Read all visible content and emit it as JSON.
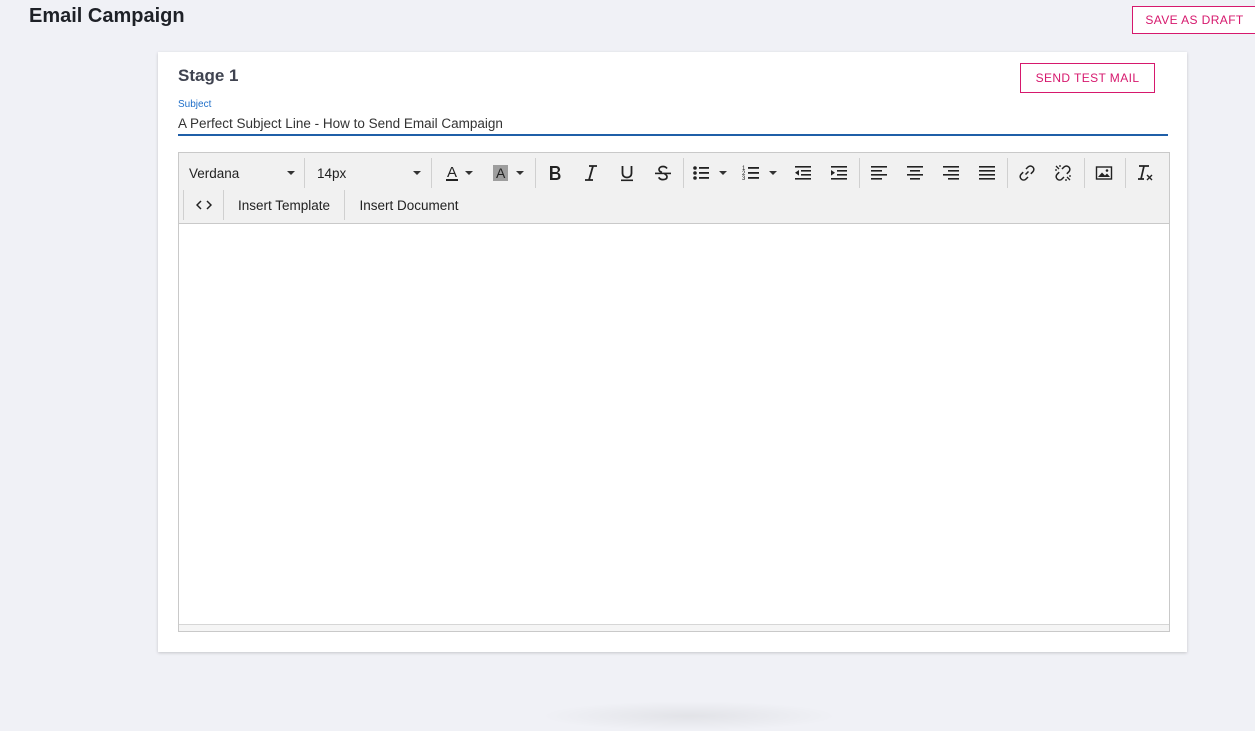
{
  "header": {
    "title": "Email Campaign",
    "save_draft_label": "SAVE AS DRAFT"
  },
  "stage": {
    "title": "Stage 1",
    "send_test_label": "SEND TEST MAIL",
    "subject_label": "Subject",
    "subject_value": "A Perfect Subject Line - How to Send Email Campaign"
  },
  "toolbar": {
    "font_family": "Verdana",
    "font_size": "14px",
    "insert_template_label": "Insert Template",
    "insert_document_label": "Insert Document",
    "icons": [
      "font-color-icon",
      "highlight-color-icon",
      "bold-icon",
      "italic-icon",
      "underline-icon",
      "strikethrough-icon",
      "bulleted-list-icon",
      "numbered-list-icon",
      "outdent-icon",
      "indent-icon",
      "align-left-icon",
      "align-center-icon",
      "align-right-icon",
      "align-justify-icon",
      "link-icon",
      "unlink-icon",
      "image-icon",
      "clear-formatting-icon",
      "source-code-icon"
    ]
  },
  "colors": {
    "accent": "#d6186d",
    "input_underline": "#1f5fa8",
    "label_blue": "#1f6fc9",
    "background": "#f0f1f6"
  }
}
